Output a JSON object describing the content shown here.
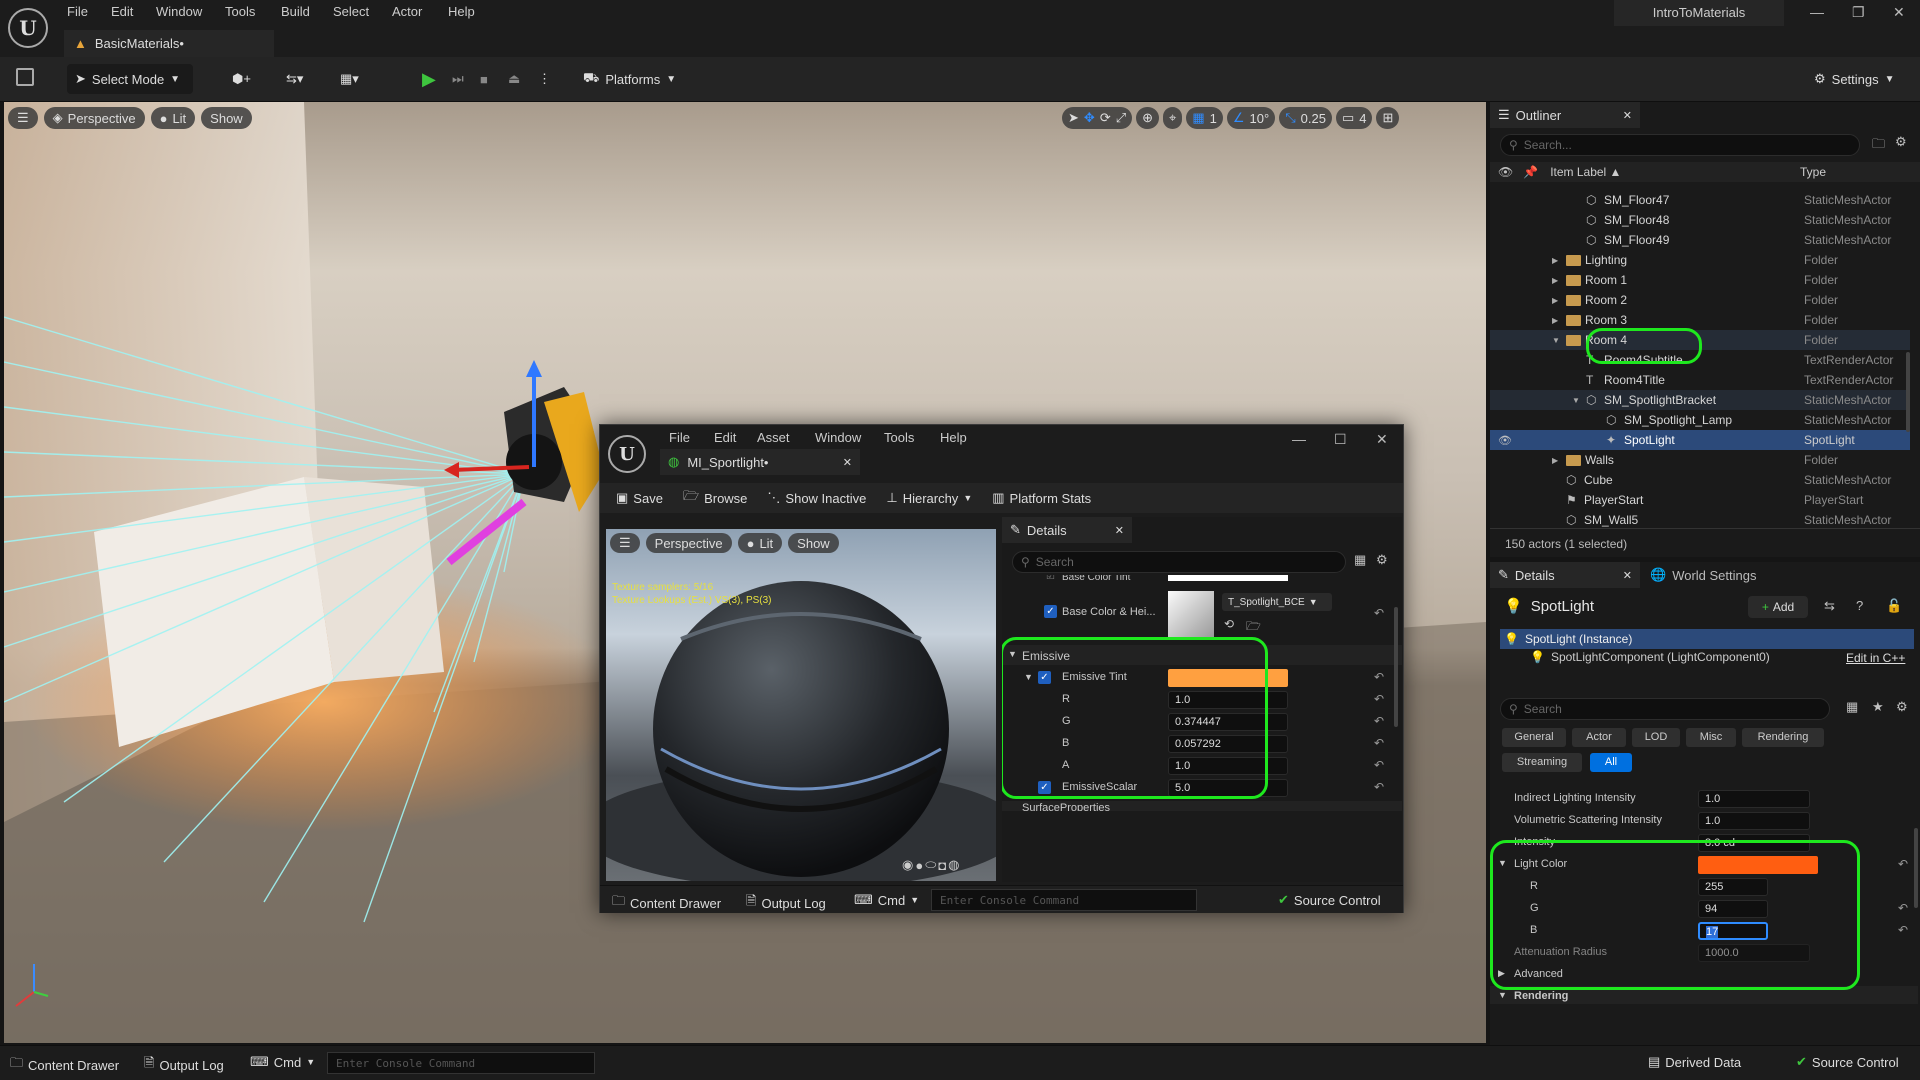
{
  "app": {
    "menu": [
      "File",
      "Edit",
      "Window",
      "Tools",
      "Build",
      "Select",
      "Actor",
      "Help"
    ],
    "project_name": "IntroToMaterials",
    "document_tab": "BasicMaterials•"
  },
  "toolbar": {
    "select_mode": "Select Mode",
    "platforms": "Platforms",
    "settings": "Settings"
  },
  "viewport": {
    "perspective": "Perspective",
    "lit": "Lit",
    "show": "Show",
    "grid_value": "1",
    "angle_value": "10°",
    "scale_value": "0.25",
    "camera_speed": "4"
  },
  "outliner": {
    "tab": "Outliner",
    "search_placeholder": "Search...",
    "col_label": "Item Label ▲",
    "col_type": "Type",
    "rows": [
      {
        "label": "SM_Floor47",
        "type": "StaticMeshActor"
      },
      {
        "label": "SM_Floor48",
        "type": "StaticMeshActor"
      },
      {
        "label": "SM_Floor49",
        "type": "StaticMeshActor"
      },
      {
        "label": "Lighting",
        "type": "Folder"
      },
      {
        "label": "Room 1",
        "type": "Folder"
      },
      {
        "label": "Room 2",
        "type": "Folder"
      },
      {
        "label": "Room 3",
        "type": "Folder"
      },
      {
        "label": "Room 4",
        "type": "Folder"
      },
      {
        "label": "Room4Subtitle",
        "type": "TextRenderActor"
      },
      {
        "label": "Room4Title",
        "type": "TextRenderActor"
      },
      {
        "label": "SM_SpotlightBracket",
        "type": "StaticMeshActor"
      },
      {
        "label": "SM_Spotlight_Lamp",
        "type": "StaticMeshActor"
      },
      {
        "label": "SpotLight",
        "type": "SpotLight"
      },
      {
        "label": "Walls",
        "type": "Folder"
      },
      {
        "label": "Cube",
        "type": "StaticMeshActor"
      },
      {
        "label": "PlayerStart",
        "type": "PlayerStart"
      },
      {
        "label": "SM_Wall5",
        "type": "StaticMeshActor"
      }
    ],
    "status": "150 actors (1 selected)"
  },
  "details": {
    "tab": "Details",
    "world_settings_tab": "World Settings",
    "actor_name": "SpotLight",
    "add_button": "Add",
    "instance": "SpotLight (Instance)",
    "component": "SpotLightComponent (LightComponent0)",
    "edit_cpp": "Edit in C++",
    "search_placeholder": "Search",
    "filters": [
      "General",
      "Actor",
      "LOD",
      "Misc",
      "Rendering",
      "Streaming",
      "All"
    ],
    "props": {
      "indirect_label": "Indirect Lighting Intensity",
      "indirect_value": "1.0",
      "volumetric_label": "Volumetric Scattering Intensity",
      "volumetric_value": "1.0",
      "intensity_label": "Intensity",
      "intensity_value": "8.0 cd",
      "light_color_label": "Light Color",
      "light_color_hex": "#ff5e11",
      "r_label": "R",
      "r_value": "255",
      "g_label": "G",
      "g_value": "94",
      "b_label": "B",
      "b_value": "17",
      "attenuation_label": "Attenuation Radius",
      "attenuation_value": "1000.0",
      "advanced": "Advanced",
      "rendering": "Rendering"
    }
  },
  "material_editor": {
    "menu": [
      "File",
      "Edit",
      "Asset",
      "Window",
      "Tools",
      "Help"
    ],
    "tab": "MI_Sportlight•",
    "toolbar": {
      "save": "Save",
      "browse": "Browse",
      "show_inactive": "Show Inactive",
      "hierarchy": "Hierarchy",
      "platform_stats": "Platform Stats"
    },
    "preview": {
      "perspective": "Perspective",
      "lit": "Lit",
      "show": "Show",
      "stats_line1": "Texture samplers: 5/16",
      "stats_line2": "Texture Lookups (Est.) VS(3), PS(3)"
    },
    "details": {
      "tab": "Details",
      "search_placeholder": "Search",
      "base_color_tint": "Base Color Tint",
      "base_color_height": "Base Color & Hei...",
      "texture_name": "T_Spotlight_BCE",
      "emissive_group": "Emissive",
      "emissive_tint": "Emissive Tint",
      "emissive_tint_hex": "#ffa040",
      "r_label": "R",
      "r_value": "1.0",
      "g_label": "G",
      "g_value": "0.374447",
      "b_label": "B",
      "b_value": "0.057292",
      "a_label": "A",
      "a_value": "1.0",
      "emissive_scalar": "EmissiveScalar",
      "emissive_scalar_value": "5.0",
      "surface_props": "SurfaceProperties"
    },
    "bottom": {
      "content_drawer": "Content Drawer",
      "output_log": "Output Log",
      "cmd": "Cmd",
      "console_placeholder": "Enter Console Command",
      "source_control": "Source Control"
    }
  },
  "statusbar": {
    "content_drawer": "Content Drawer",
    "output_log": "Output Log",
    "cmd": "Cmd",
    "console_placeholder": "Enter Console Command",
    "derived_data": "Derived Data",
    "source_control": "Source Control"
  },
  "colors": {
    "accent_green": "#1ee81e",
    "selection_blue": "#2c4a7a",
    "ue_blue": "#0070e0"
  }
}
